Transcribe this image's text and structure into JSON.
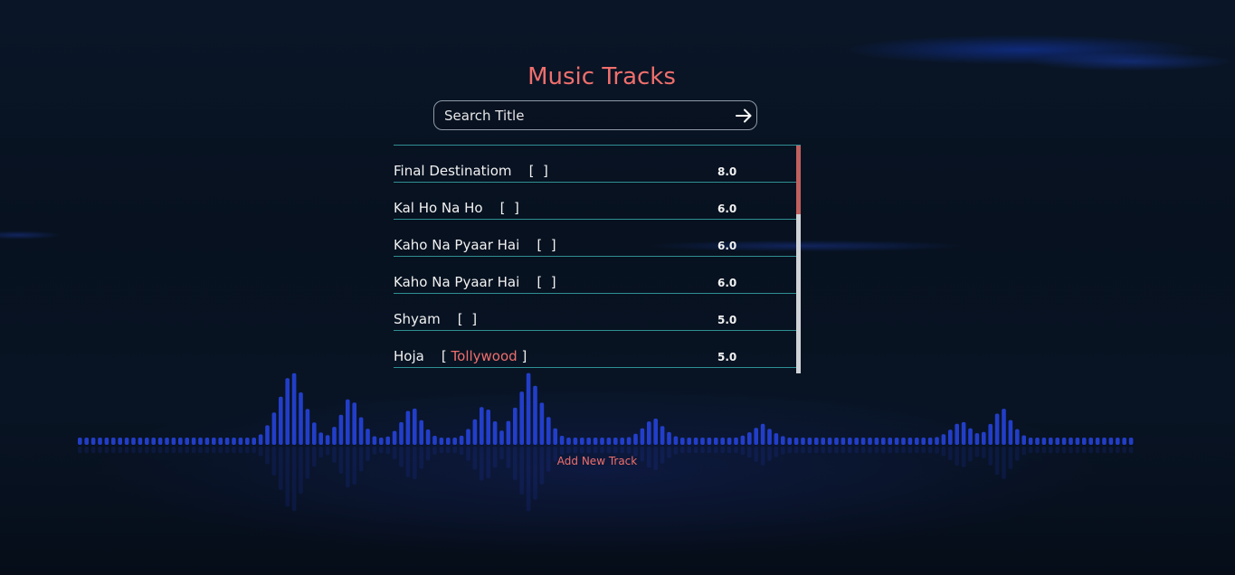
{
  "page_title": "Music Tracks",
  "search": {
    "placeholder": "Search Title",
    "value": ""
  },
  "tracks": [
    {
      "title": "Final Destinatiom",
      "genre": "",
      "rating": "8.0"
    },
    {
      "title": "Kal Ho Na Ho",
      "genre": "",
      "rating": "6.0"
    },
    {
      "title": "Kaho Na Pyaar Hai",
      "genre": "",
      "rating": "6.0"
    },
    {
      "title": "Kaho Na Pyaar Hai",
      "genre": "",
      "rating": "6.0"
    },
    {
      "title": "Shyam",
      "genre": "",
      "rating": "5.0"
    },
    {
      "title": "Hoja",
      "genre": "Tollywood",
      "rating": "5.0"
    },
    {
      "title": "",
      "genre": "",
      "rating": ""
    }
  ],
  "add_track_label": "Add New Track",
  "colors": {
    "accent": "#ef6f6c",
    "divider": "#2f8f93",
    "background": "#07101f",
    "visualizer": "#2b4cff"
  },
  "icons": {
    "search_submit": "arrow-right-icon"
  }
}
